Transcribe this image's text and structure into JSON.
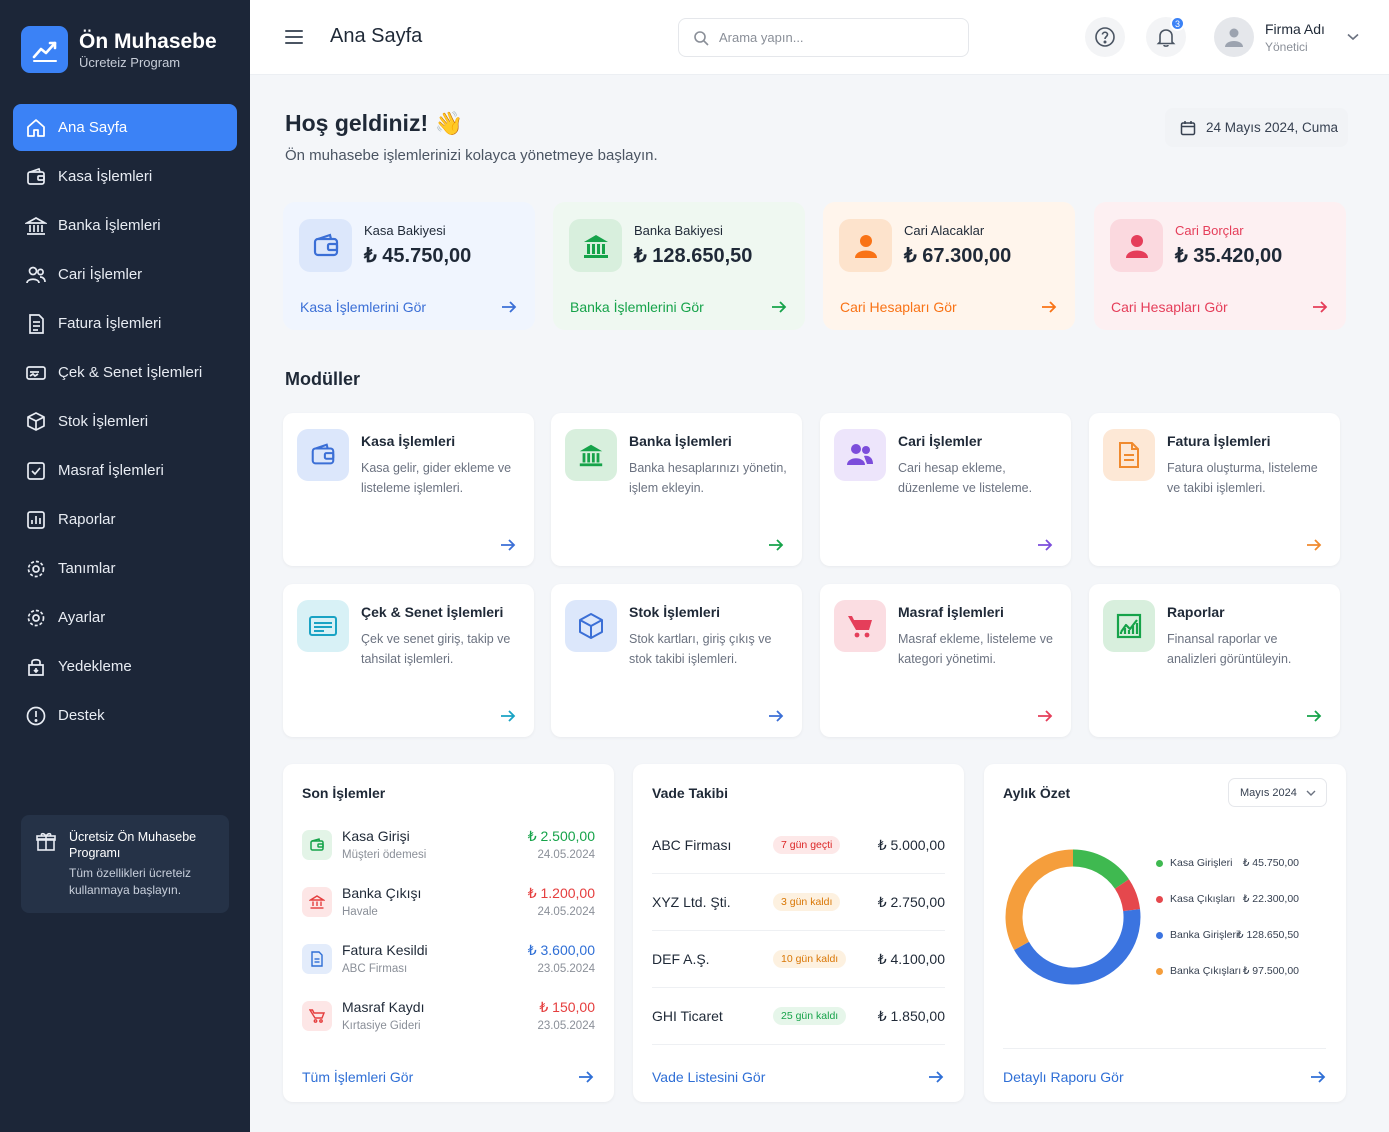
{
  "brand": {
    "title": "Ön Muhasebe",
    "subtitle": "Ücreteiz Program"
  },
  "sidebar": {
    "items": [
      {
        "label": "Ana Sayfa",
        "icon": "home-icon",
        "active": true
      },
      {
        "label": "Kasa İşlemleri",
        "icon": "wallet-icon"
      },
      {
        "label": "Banka İşlemleri",
        "icon": "bank-icon"
      },
      {
        "label": "Cari İşlemler",
        "icon": "users-icon"
      },
      {
        "label": "Fatura İşlemleri",
        "icon": "invoice-icon"
      },
      {
        "label": "Çek & Senet İşlemleri",
        "icon": "check-icon"
      },
      {
        "label": "Stok İşlemleri",
        "icon": "box-icon"
      },
      {
        "label": "Masraf İşlemleri",
        "icon": "expense-icon"
      },
      {
        "label": "Raporlar",
        "icon": "report-icon"
      },
      {
        "label": "Tanımlar",
        "icon": "definitions-icon"
      },
      {
        "label": "Ayarlar",
        "icon": "settings-icon"
      },
      {
        "label": "Yedekleme",
        "icon": "backup-icon"
      },
      {
        "label": "Destek",
        "icon": "support-icon"
      }
    ],
    "promo": {
      "title": "Ücretsiz Ön Muhasebe Programı",
      "text": "Tüm özellikleri ücreteiz kullanmaya başlayın."
    }
  },
  "header": {
    "title": "Ana Sayfa",
    "search_placeholder": "Arama yapın...",
    "notification_count": "3",
    "user_name": "Firma Adı",
    "user_role": "Yönetici"
  },
  "welcome": {
    "title": "Hoş geldiniz! 👋",
    "subtitle": "Ön muhasebe işlemlerinizi kolayca yönetmeye başlayın.",
    "date": "24 Mayıs 2024, Cuma"
  },
  "summary": [
    {
      "label": "Kasa Bakiyesi",
      "value": "₺ 45.750,00",
      "link": "Kasa İşlemlerini Gör",
      "color": "#3b6fd6"
    },
    {
      "label": "Banka Bakiyesi",
      "value": "₺ 128.650,50",
      "link": "Banka İşlemlerini Gör",
      "color": "#16a34a"
    },
    {
      "label": "Cari Alacaklar",
      "value": "₺ 67.300,00",
      "link": "Cari Hesapları Gör",
      "color": "#f97316"
    },
    {
      "label": "Cari Borçlar",
      "value": "₺ 35.420,00",
      "link": "Cari Hesapları Gör",
      "color": "#e53e5a"
    }
  ],
  "modules": {
    "title": "Modüller",
    "items": [
      {
        "title": "Kasa İşlemleri",
        "desc": "Kasa gelir, gider ekleme ve listeleme işlemleri."
      },
      {
        "title": "Banka İşlemleri",
        "desc": "Banka hesaplarınızı yönetin, işlem ekleyin."
      },
      {
        "title": "Cari İşlemler",
        "desc": "Cari hesap ekleme, düzenleme ve listeleme."
      },
      {
        "title": "Fatura İşlemleri",
        "desc": "Fatura oluşturma, listeleme ve takibi işlemleri."
      },
      {
        "title": "Çek & Senet İşlemleri",
        "desc": "Çek ve senet giriş, takip ve tahsilat işlemleri."
      },
      {
        "title": "Stok İşlemleri",
        "desc": "Stok kartları, giriş çıkış ve stok takibi işlemleri."
      },
      {
        "title": "Masraf İşlemleri",
        "desc": "Masraf ekleme, listeleme ve kategori yönetimi."
      },
      {
        "title": "Raporlar",
        "desc": "Finansal raporlar ve analizleri görüntüleyin."
      }
    ]
  },
  "recent": {
    "title": "Son İşlemler",
    "items": [
      {
        "name": "Kasa Girişi",
        "sub": "Müşteri ödemesi",
        "amount": "₺ 2.500,00",
        "date": "24.05.2024",
        "color": "#16a34a"
      },
      {
        "name": "Banka Çıkışı",
        "sub": "Havale",
        "amount": "₺ 1.200,00",
        "date": "24.05.2024",
        "color": "#e53e3e"
      },
      {
        "name": "Fatura Kesildi",
        "sub": "ABC Firması",
        "amount": "₺ 3.600,00",
        "date": "23.05.2024",
        "color": "#2f6fd6"
      },
      {
        "name": "Masraf Kaydı",
        "sub": "Kırtasiye Gideri",
        "amount": "₺ 150,00",
        "date": "23.05.2024",
        "color": "#e53e3e"
      }
    ],
    "footer": "Tüm İşlemleri Gör"
  },
  "due": {
    "title": "Vade Takibi",
    "items": [
      {
        "name": "ABC Firması",
        "badge": "7 gün geçti",
        "amount": "₺ 5.000,00",
        "color": "#dc2626",
        "bg": "#fde8e8"
      },
      {
        "name": "XYZ Ltd. Şti.",
        "badge": "3 gün kaldı",
        "amount": "₺ 2.750,00",
        "color": "#d97706",
        "bg": "#fdf1e0"
      },
      {
        "name": "DEF A.Ş.",
        "badge": "10 gün kaldı",
        "amount": "₺ 4.100,00",
        "color": "#d97706",
        "bg": "#fdf1e0"
      },
      {
        "name": "GHI Ticaret",
        "badge": "25 gün kaldı",
        "amount": "₺ 1.850,00",
        "color": "#16a34a",
        "bg": "#e6f6ea"
      }
    ],
    "footer": "Vade Listesini Gör"
  },
  "monthly": {
    "title": "Aylık Özet",
    "month": "Mayıs 2024",
    "footer": "Detaylı Raporu Gör"
  },
  "chart_data": {
    "type": "pie",
    "categories": [
      "Kasa Girişleri",
      "Kasa Çıkışları",
      "Banka Girişleri",
      "Banka Çıkışları"
    ],
    "values": [
      45750,
      22300,
      128650.5,
      97500
    ],
    "value_labels": [
      "₺ 45.750,00",
      "₺ 22.300,00",
      "₺ 128.650,50",
      "₺ 97.500,00"
    ],
    "colors": [
      "#3fb950",
      "#e5484d",
      "#3b74e0",
      "#f59e3c"
    ],
    "legend": "right"
  }
}
